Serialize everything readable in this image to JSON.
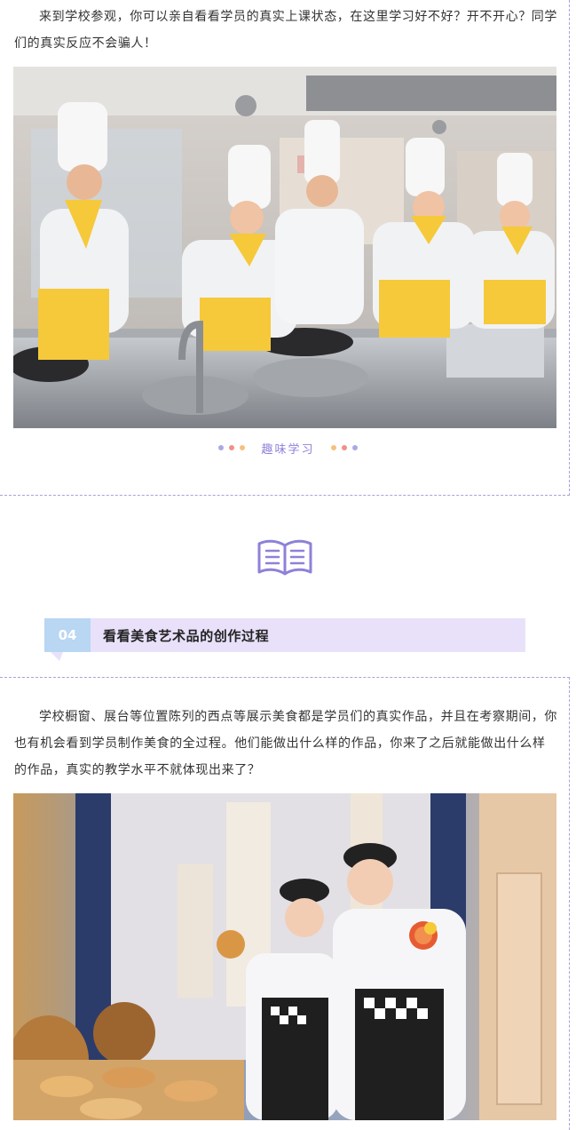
{
  "section1": {
    "paragraph": "来到学校参观，你可以亲自看看学员的真实上课状态，在这里学习好不好？开不开心？同学们的真实反应不会骗人！",
    "caption": "趣味学习",
    "caption_dots_left": [
      "#a9a9e8",
      "#f0908a",
      "#f5c27a"
    ],
    "caption_dots_right": [
      "#f5c27a",
      "#f0908a",
      "#a9a9e8"
    ]
  },
  "section2": {
    "tag_number": "04",
    "tag_title": "看看美食艺术品的创作过程",
    "paragraph": "学校橱窗、展台等位置陈列的西点等展示美食都是学员们的真实作品，并且在考察期间，你也有机会看到学员制作美食的全过程。他们能做出什么样的作品，你来了之后就能做出什么样的作品，真实的教学水平不就体现出来了？"
  },
  "icons": {
    "book": "open-book-icon"
  },
  "colors": {
    "accent_purple": "#8c82d9",
    "tag_blue": "#b9d6f3",
    "tag_lavender": "#e9e1fa",
    "dashed_border": "#a9a2d6",
    "chef_yellow": "#f6c93a"
  }
}
